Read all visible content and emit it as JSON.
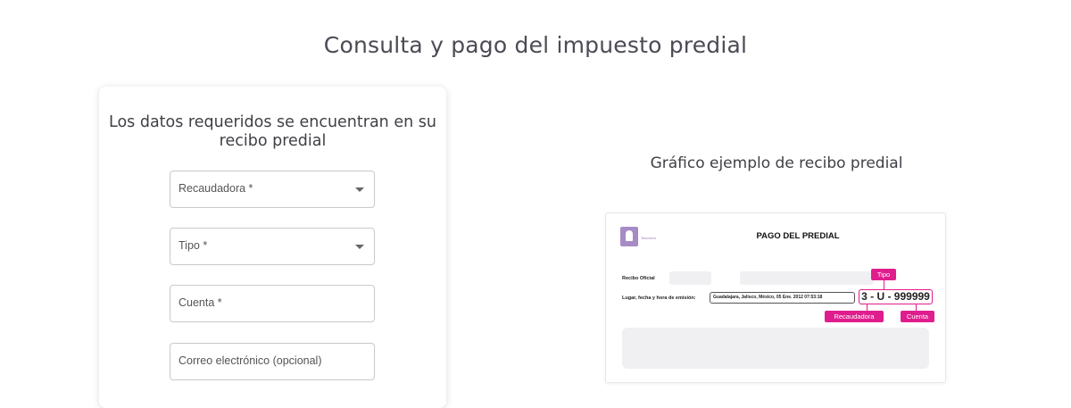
{
  "page": {
    "title": "Consulta y pago del impuesto predial"
  },
  "form": {
    "heading": "Los datos requeridos se encuentran en su recibo predial",
    "recaudadora_label": "Recaudadora *",
    "tipo_label": "Tipo *",
    "cuenta_label": "Cuenta *",
    "email_label": "Correo electrónico (opcional)"
  },
  "example": {
    "title": "Gráfico ejemplo de recibo predial",
    "receipt": {
      "logo_text": "Tesorería",
      "title": "PAGO DEL PREDIAL",
      "recibo_label": "Recibo Oficial",
      "lugar_label": "Lugar, fecha y hora de emisión:",
      "lugar_value": "Guadalajara, Jalisco, México, 05 Ene. 2012 07:53:18",
      "code": "3 - U - 999999",
      "tag_tipo": "Tipo",
      "tag_recaudadora": "Recaudadora",
      "tag_cuenta": "Cuenta"
    }
  },
  "colors": {
    "accent": "#e01d8d",
    "logo": "#a78bc4"
  }
}
